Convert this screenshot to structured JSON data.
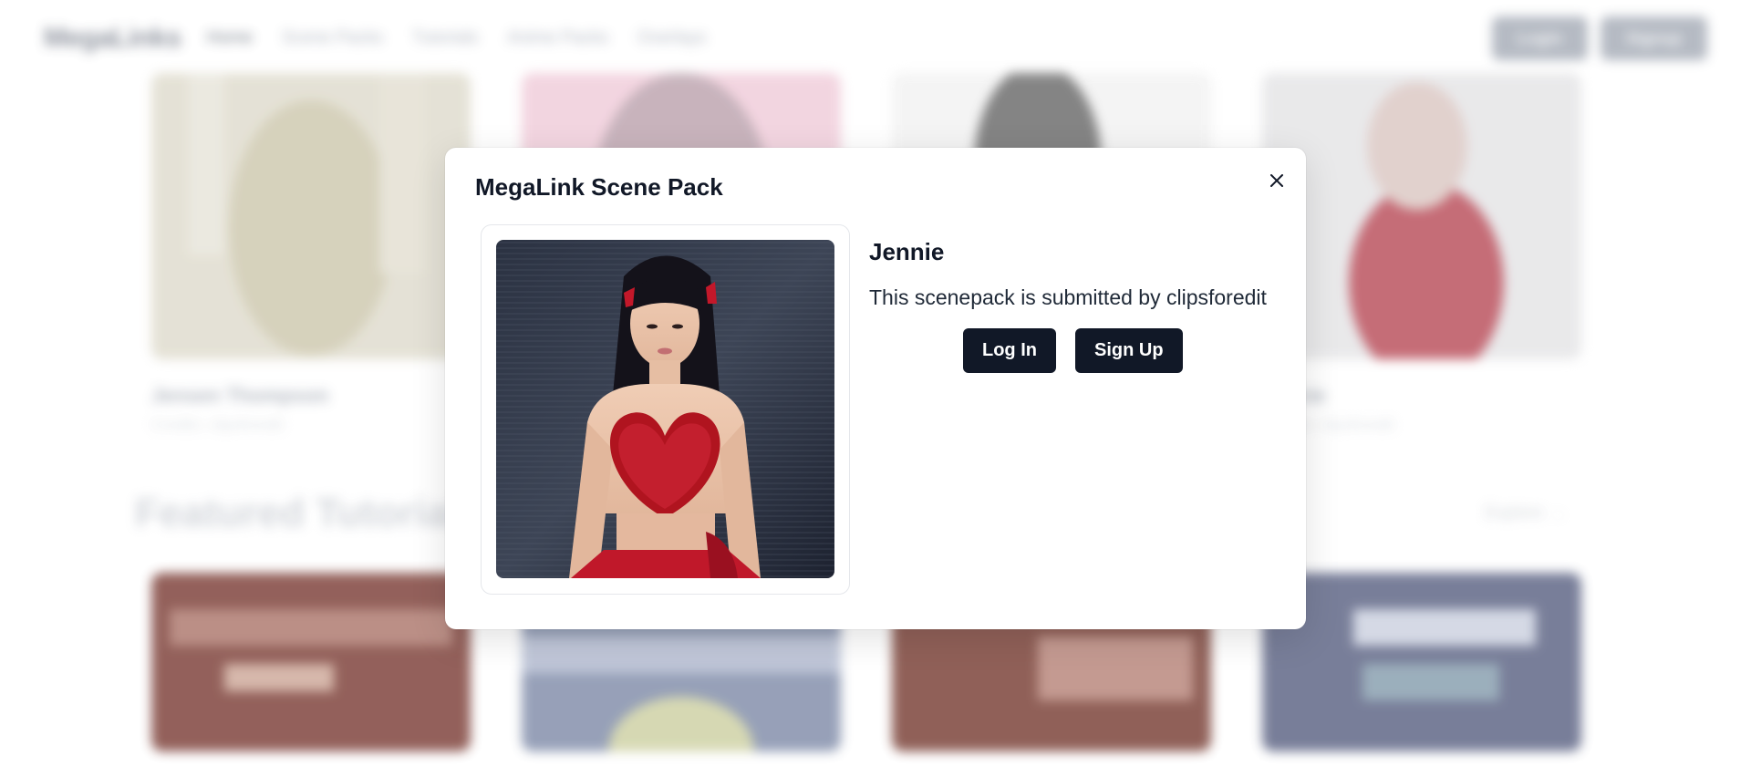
{
  "nav": {
    "logo": "MegaLinks",
    "links": [
      "Home",
      "Scene Packs",
      "Tutorials",
      "Anime Packs",
      "Overlays"
    ],
    "login_label": "Login",
    "signup_label": "Signup"
  },
  "background": {
    "cards_top": [
      {
        "title": "Jensen Thompson",
        "subtitle": "Credits: clipsforedit"
      },
      {
        "title": "",
        "subtitle": ""
      },
      {
        "title": "",
        "subtitle": ""
      },
      {
        "title": "Jennie",
        "subtitle": "Credits: clipsforedit"
      }
    ],
    "section_title": "Featured Tutorials",
    "explore_label": "Explore →"
  },
  "modal": {
    "title": "MegaLink Scene Pack",
    "close_icon": "close-icon",
    "image_alt": "Jennie scene pack thumbnail",
    "name": "Jennie",
    "description": "This scenepack is submitted by clipsforedit",
    "login_label": "Log In",
    "signup_label": "Sign Up"
  },
  "colors": {
    "primary_button": "#111827",
    "background": "#ffffff"
  }
}
